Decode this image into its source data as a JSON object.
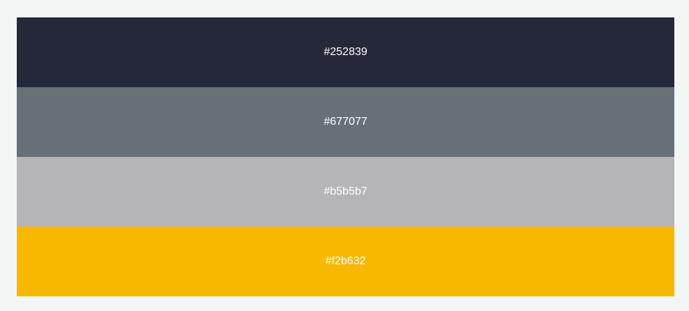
{
  "page": {
    "background": "#f2f6f5"
  },
  "palette": {
    "swatches": [
      {
        "label": "#252839",
        "color": "#252839",
        "text_color": "#ffffff"
      },
      {
        "label": "#677077",
        "color": "#677077",
        "text_color": "#ffffff"
      },
      {
        "label": "#b5b5b7",
        "color": "#b5b5b7",
        "text_color": "#ffffff"
      },
      {
        "label": "#f2b632",
        "color": "#f9b800",
        "text_color": "#ffffff"
      }
    ]
  }
}
